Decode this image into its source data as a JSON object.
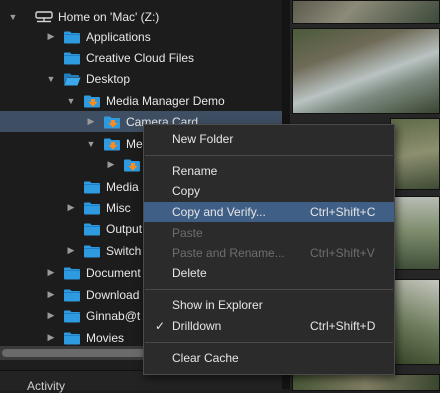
{
  "tree": {
    "root_label": "Home on 'Mac' (Z:)",
    "items": [
      {
        "label": "Applications"
      },
      {
        "label": "Creative Cloud Files"
      },
      {
        "label": "Desktop"
      },
      {
        "label": "Media Manager Demo"
      },
      {
        "label": "Camera Card"
      },
      {
        "label": "Me"
      },
      {
        "label": ""
      },
      {
        "label": "Media"
      },
      {
        "label": "Misc"
      },
      {
        "label": "Output"
      },
      {
        "label": "Switch"
      },
      {
        "label": "Document"
      },
      {
        "label": "Download"
      },
      {
        "label": "Ginnab@t"
      },
      {
        "label": "Movies"
      }
    ]
  },
  "activity": {
    "title": "Activity"
  },
  "context_menu": {
    "items": [
      {
        "label": "New Folder",
        "shortcut": ""
      },
      {
        "label": "Rename",
        "shortcut": ""
      },
      {
        "label": "Copy",
        "shortcut": ""
      },
      {
        "label": "Copy and Verify...",
        "shortcut": "Ctrl+Shift+C"
      },
      {
        "label": "Paste",
        "shortcut": ""
      },
      {
        "label": "Paste and Rename...",
        "shortcut": "Ctrl+Shift+V"
      },
      {
        "label": "Delete",
        "shortcut": ""
      },
      {
        "label": "Show in Explorer",
        "shortcut": ""
      },
      {
        "label": "Drilldown",
        "shortcut": "Ctrl+Shift+D"
      },
      {
        "label": "Clear Cache",
        "shortcut": ""
      }
    ],
    "check_mark": "✓"
  },
  "colors": {
    "folder": "#2e9be0",
    "orange_badge": "#ff8c1a",
    "menu_highlight": "#3f5f86",
    "tree_selection": "#3f4f63"
  }
}
